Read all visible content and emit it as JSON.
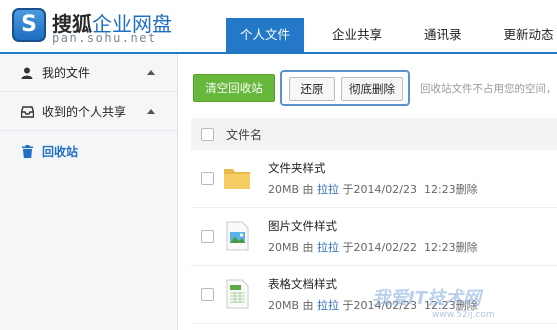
{
  "brand": {
    "badge": "S",
    "title_main": "搜狐",
    "title_accent": "企业网盘",
    "domain": "pan.sohu.net"
  },
  "nav": [
    "个人文件",
    "企业共享",
    "通讯录",
    "更新动态"
  ],
  "sidebar": {
    "items": [
      {
        "label": "我的文件",
        "icon": "user-icon"
      },
      {
        "label": "收到的个人共享",
        "icon": "inbox-icon"
      },
      {
        "label": "回收站",
        "icon": "trash-icon"
      }
    ]
  },
  "toolbar": {
    "clear_label": "清空回收站",
    "restore_label": "还原",
    "delete_label": "彻底删除",
    "hint": "回收站文件不占用您的空间，"
  },
  "table": {
    "header": "文件名",
    "rows": [
      {
        "name": "文件夹样式",
        "size": "20MB",
        "by": "由",
        "owner": "拉拉",
        "at": "于2014/02/23",
        "time": "12:23删除",
        "icon": "folder-icon"
      },
      {
        "name": "图片文件样式",
        "size": "20MB",
        "by": "由",
        "owner": "拉拉",
        "at": "于2014/02/22",
        "time": "12:23删除",
        "icon": "image-file-icon"
      },
      {
        "name": "表格文档样式",
        "size": "20MB",
        "by": "由",
        "owner": "拉拉",
        "at": "于2014/02/23",
        "time": "12:23删除",
        "icon": "spreadsheet-file-icon"
      }
    ]
  },
  "watermark": {
    "text": "我爱IT技术网",
    "url": "www.52ij.com"
  },
  "colors": {
    "accent": "#2378c8",
    "green": "#66b83a",
    "link": "#2a6ac0"
  }
}
